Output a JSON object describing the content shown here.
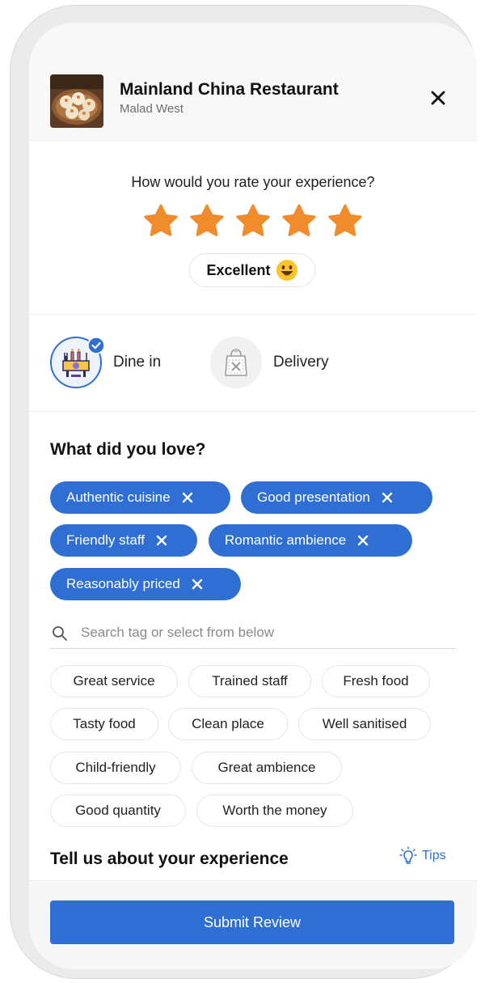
{
  "restaurant": {
    "name": "Mainland China Restaurant",
    "location": "Malad West"
  },
  "rating": {
    "question": "How would you rate your experience?",
    "stars": 5,
    "max_stars": 5,
    "label": "Excellent",
    "emoji": "😃"
  },
  "modes": [
    {
      "label": "Dine in",
      "selected": true,
      "icon": "dine-in-icon"
    },
    {
      "label": "Delivery",
      "selected": false,
      "icon": "delivery-bag-icon"
    }
  ],
  "love": {
    "title": "What did you love?",
    "selected_tags": [
      "Authentic cuisine",
      "Good presentation",
      "Friendly staff",
      "Romantic ambience",
      "Reasonably priced"
    ],
    "search_placeholder": "Search tag or select from below",
    "suggested_tags": [
      "Great service",
      "Trained staff",
      "Fresh food",
      "Tasty food",
      "Clean place",
      "Well sanitised",
      "Child-friendly",
      "Great ambience",
      "Good quantity",
      "Worth the money"
    ]
  },
  "experience": {
    "title": "Tell us about your experience",
    "tips_label": "Tips"
  },
  "submit_label": "Submit Review",
  "colors": {
    "accent": "#2f6fd4",
    "star": "#f08c2c",
    "header_bg": "#f8f8f8"
  }
}
